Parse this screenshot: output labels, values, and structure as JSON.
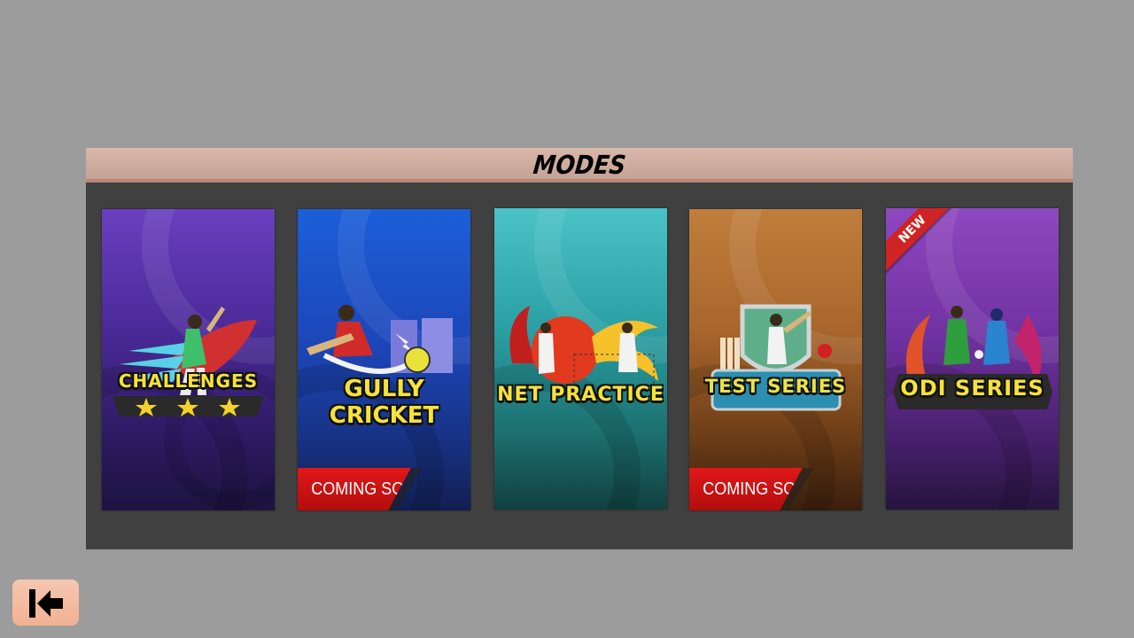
{
  "header": {
    "title": "MODES"
  },
  "modes": [
    {
      "label": "CHALLENGES",
      "ribbon": "",
      "theme": "purple"
    },
    {
      "label": "GULLY CRICKET",
      "ribbon": "COMING SOON",
      "theme": "blue"
    },
    {
      "label": "NET PRACTICE",
      "ribbon": "",
      "theme": "teal"
    },
    {
      "label": "TEST SERIES",
      "ribbon": "COMING SOON",
      "theme": "orange"
    },
    {
      "label": "ODI SERIES",
      "ribbon": "",
      "badge": "NEW",
      "theme": "violet"
    }
  ],
  "colors": {
    "background": "#9c9c9c",
    "panel": "#404040",
    "header": "#d2b0a2",
    "ribbon": "#d11414",
    "logo_text": "#f6e23a",
    "back_button": "#f3bba1"
  },
  "icons": {
    "back": "back-arrow-icon"
  }
}
